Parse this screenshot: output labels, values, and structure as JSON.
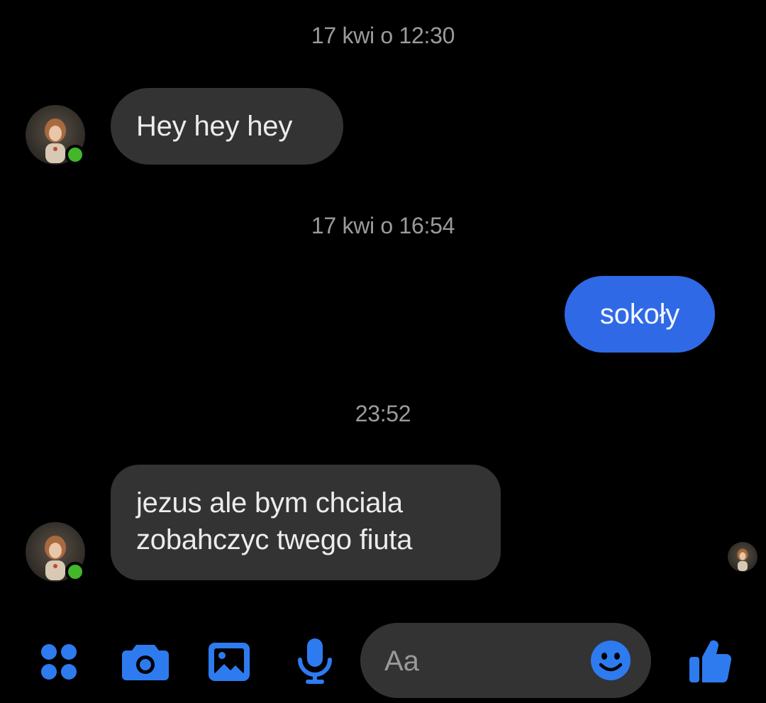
{
  "conversation": {
    "timestamps": [
      "17 kwi o 12:30",
      "17 kwi o 16:54",
      "23:52"
    ],
    "messages": [
      {
        "direction": "incoming",
        "text": "Hey hey hey"
      },
      {
        "direction": "outgoing",
        "text": "sokoły"
      },
      {
        "direction": "incoming",
        "lines": [
          "jezus ale bym chciala",
          "zobahczyc twego fiuta"
        ]
      }
    ]
  },
  "composer": {
    "placeholder": "Aa"
  },
  "toolbar": {
    "icons": [
      "apps-icon",
      "camera-icon",
      "gallery-icon",
      "microphone-icon",
      "emoji-icon",
      "thumbs-up-icon"
    ]
  },
  "colors": {
    "background": "#000000",
    "incoming_bubble": "#333334",
    "outgoing_bubble": "#2f69e6",
    "accent": "#2e7bf0",
    "online": "#42b72a",
    "timestamp": "#9b9b9b"
  }
}
